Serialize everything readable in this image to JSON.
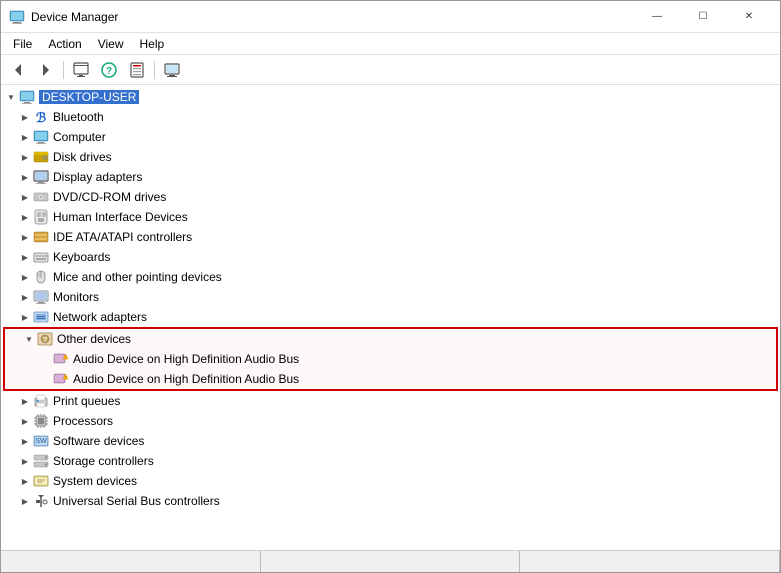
{
  "window": {
    "title": "Device Manager",
    "titlebar_buttons": {
      "minimize": "—",
      "maximize": "☐",
      "close": "✕"
    }
  },
  "menu": {
    "items": [
      "File",
      "Action",
      "View",
      "Help"
    ]
  },
  "toolbar": {
    "buttons": [
      {
        "name": "back",
        "icon": "◀"
      },
      {
        "name": "forward",
        "icon": "▶"
      },
      {
        "name": "properties",
        "icon": "🖥"
      },
      {
        "name": "update-driver",
        "icon": "❓"
      },
      {
        "name": "uninstall",
        "icon": "🗑"
      },
      {
        "name": "scan",
        "icon": "🖥"
      }
    ]
  },
  "tree": {
    "root": {
      "label": "DESKTOP-USER",
      "expanded": true
    },
    "items": [
      {
        "id": "bluetooth",
        "label": "Bluetooth",
        "indent": 1,
        "expanded": false,
        "icon": "bluetooth"
      },
      {
        "id": "computer",
        "label": "Computer",
        "indent": 1,
        "expanded": false,
        "icon": "computer"
      },
      {
        "id": "disk-drives",
        "label": "Disk drives",
        "indent": 1,
        "expanded": false,
        "icon": "disk"
      },
      {
        "id": "display-adapters",
        "label": "Display adapters",
        "indent": 1,
        "expanded": false,
        "icon": "display"
      },
      {
        "id": "dvd",
        "label": "DVD/CD-ROM drives",
        "indent": 1,
        "expanded": false,
        "icon": "dvd"
      },
      {
        "id": "hid",
        "label": "Human Interface Devices",
        "indent": 1,
        "expanded": false,
        "icon": "hid"
      },
      {
        "id": "ide",
        "label": "IDE ATA/ATAPI controllers",
        "indent": 1,
        "expanded": false,
        "icon": "ide"
      },
      {
        "id": "keyboards",
        "label": "Keyboards",
        "indent": 1,
        "expanded": false,
        "icon": "keyboard"
      },
      {
        "id": "mice",
        "label": "Mice and other pointing devices",
        "indent": 1,
        "expanded": false,
        "icon": "mouse"
      },
      {
        "id": "monitors",
        "label": "Monitors",
        "indent": 1,
        "expanded": false,
        "icon": "monitor"
      },
      {
        "id": "network",
        "label": "Network adapters",
        "indent": 1,
        "expanded": false,
        "icon": "network"
      },
      {
        "id": "other-devices",
        "label": "Other devices",
        "indent": 1,
        "expanded": true,
        "icon": "other",
        "highlighted": true
      },
      {
        "id": "audio1",
        "label": "Audio Device on High Definition Audio Bus",
        "indent": 2,
        "expanded": false,
        "icon": "warning",
        "highlighted": true
      },
      {
        "id": "audio2",
        "label": "Audio Device on High Definition Audio Bus",
        "indent": 2,
        "expanded": false,
        "icon": "warning",
        "highlighted": true
      },
      {
        "id": "print",
        "label": "Print queues",
        "indent": 1,
        "expanded": false,
        "icon": "print"
      },
      {
        "id": "processors",
        "label": "Processors",
        "indent": 1,
        "expanded": false,
        "icon": "processor"
      },
      {
        "id": "software",
        "label": "Software devices",
        "indent": 1,
        "expanded": false,
        "icon": "software"
      },
      {
        "id": "storage",
        "label": "Storage controllers",
        "indent": 1,
        "expanded": false,
        "icon": "storage"
      },
      {
        "id": "system",
        "label": "System devices",
        "indent": 1,
        "expanded": false,
        "icon": "system"
      },
      {
        "id": "usb",
        "label": "Universal Serial Bus controllers",
        "indent": 1,
        "expanded": false,
        "icon": "usb"
      }
    ]
  }
}
